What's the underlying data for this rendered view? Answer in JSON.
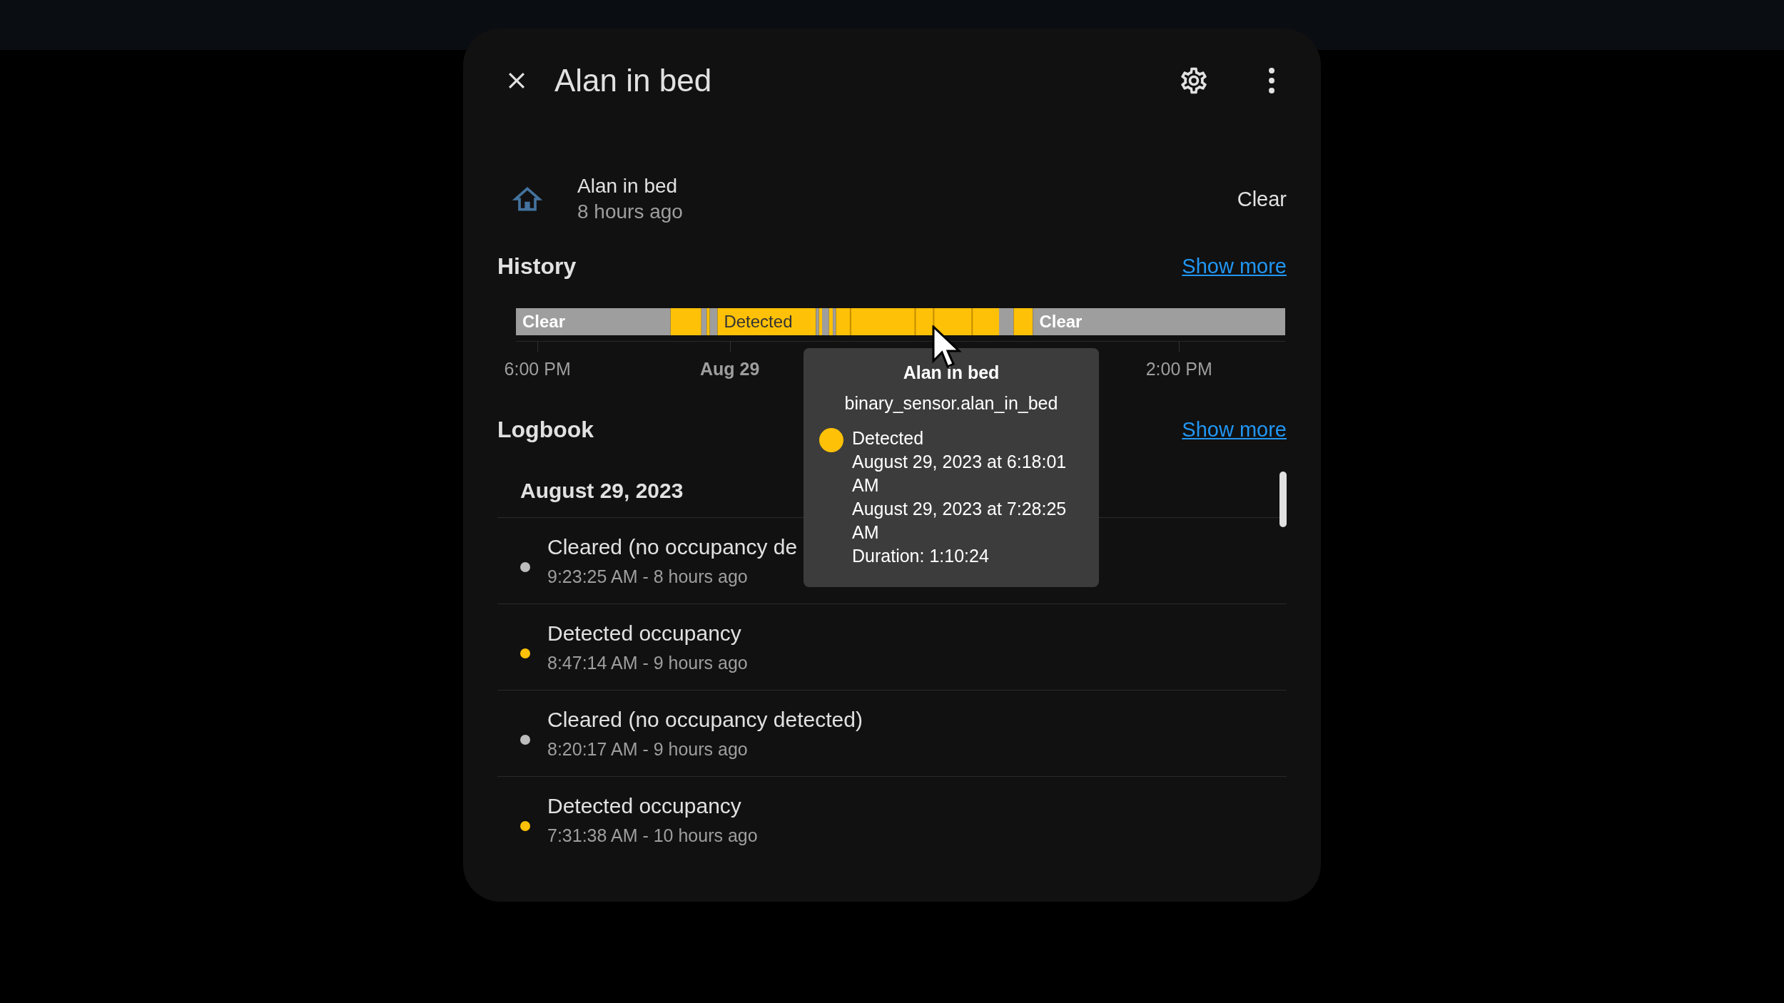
{
  "dialog": {
    "title": "Alan in bed"
  },
  "entity": {
    "name": "Alan in bed",
    "last_changed": "8 hours ago",
    "state": "Clear"
  },
  "history": {
    "heading": "History",
    "link": "Show more",
    "bar_labels": [
      {
        "text": "Clear",
        "color": "#9e9e9e"
      },
      {
        "text": "Detected",
        "color": "#ffc107"
      },
      {
        "text": "Clear",
        "color": "#9e9e9e"
      }
    ],
    "ticks": [
      {
        "label": "6:00 PM",
        "kind": "time"
      },
      {
        "label": "Aug 29",
        "kind": "date"
      },
      {
        "label": "2:00 PM",
        "kind": "time"
      }
    ],
    "tooltip": {
      "title": "Alan in bed",
      "entity_id": "binary_sensor.alan_in_bed",
      "color": "#ffc107",
      "state": "Detected",
      "lines": [
        "August 29, 2023 at 6:18:01 AM",
        "August 29, 2023 at 7:28:25 AM",
        "Duration: 1:10:24"
      ]
    }
  },
  "logbook": {
    "heading": "Logbook",
    "link": "Show more",
    "date": "August 29, 2023",
    "entries": [
      {
        "message": "Cleared (no occupancy de",
        "time": "9:23:25 AM - 8 hours ago",
        "color": "#bdbdbd"
      },
      {
        "message": "Detected occupancy",
        "time": "8:47:14 AM - 9 hours ago",
        "color": "#ffc107"
      },
      {
        "message": "Cleared (no occupancy detected)",
        "time": "8:20:17 AM - 9 hours ago",
        "color": "#bdbdbd"
      },
      {
        "message": "Detected occupancy",
        "time": "7:31:38 AM - 10 hours ago",
        "color": "#ffc107"
      }
    ]
  }
}
